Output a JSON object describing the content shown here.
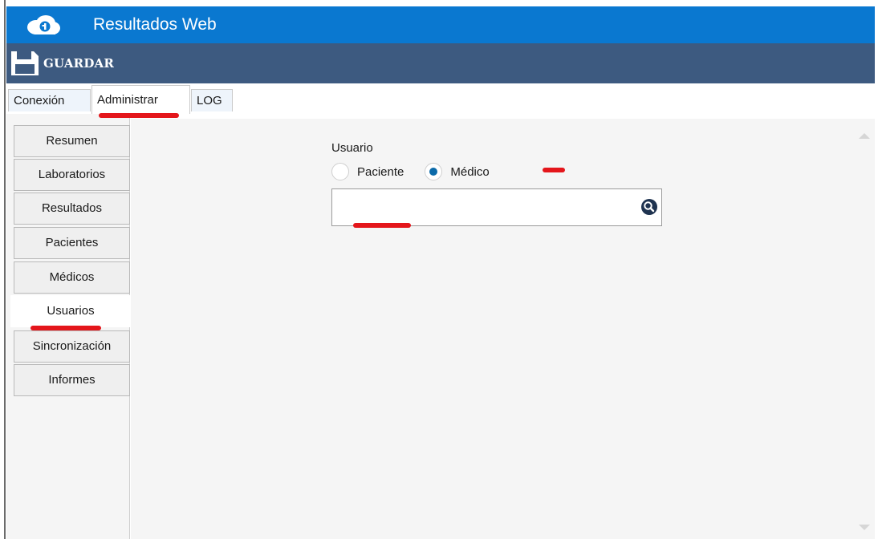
{
  "app": {
    "title": "Resultados Web"
  },
  "toolbar": {
    "save_label": "GUARDAR",
    "save_icon": "save-icon"
  },
  "tabs": [
    {
      "label": "Conexión",
      "active": false
    },
    {
      "label": "Administrar",
      "active": true
    },
    {
      "label": "LOG",
      "active": false
    }
  ],
  "sidebar": {
    "items": [
      {
        "label": "Resumen",
        "active": false
      },
      {
        "label": "Laboratorios",
        "active": false
      },
      {
        "label": "Resultados",
        "active": false
      },
      {
        "label": "Pacientes",
        "active": false
      },
      {
        "label": "Médicos",
        "active": false
      },
      {
        "label": "Usuarios",
        "active": true
      },
      {
        "label": "Sincronización",
        "active": false
      },
      {
        "label": "Informes",
        "active": false
      }
    ]
  },
  "usuarios": {
    "label": "Usuario",
    "options": [
      {
        "label": "Paciente",
        "checked": false
      },
      {
        "label": "Médico",
        "checked": true
      }
    ],
    "search_value": "",
    "search_icon": "search-icon"
  },
  "colors": {
    "titlebar": "#0a78d0",
    "toolbar": "#3d5a80",
    "radio_accent": "#0b6aa9",
    "annotation": "#e4161b"
  }
}
